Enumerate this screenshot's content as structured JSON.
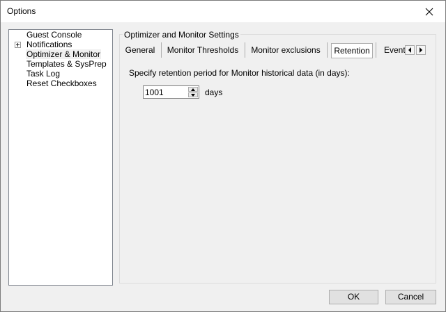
{
  "window": {
    "title": "Options",
    "close_glyph": "✕"
  },
  "tree": {
    "items": [
      {
        "label": "Guest Console",
        "expandable": false,
        "selected": false
      },
      {
        "label": "Notifications",
        "expandable": true,
        "selected": false
      },
      {
        "label": "Optimizer & Monitor",
        "expandable": false,
        "selected": true
      },
      {
        "label": "Templates & SysPrep",
        "expandable": false,
        "selected": false
      },
      {
        "label": "Task Log",
        "expandable": false,
        "selected": false
      },
      {
        "label": "Reset Checkboxes",
        "expandable": false,
        "selected": false
      }
    ]
  },
  "group": {
    "title": "Optimizer and Monitor Settings"
  },
  "tabs": {
    "items": [
      {
        "label": "General",
        "active": false
      },
      {
        "label": "Monitor Thresholds",
        "active": false
      },
      {
        "label": "Monitor exclusions",
        "active": false
      },
      {
        "label": "Retention",
        "active": true
      },
      {
        "label": "Events",
        "active": false
      }
    ],
    "scroll_left_icon": "◂",
    "scroll_right_icon": "▸"
  },
  "retention": {
    "prompt": "Specify retention period for Monitor historical data (in days):",
    "value": "1001",
    "unit": "days"
  },
  "buttons": {
    "ok": "OK",
    "cancel": "Cancel"
  }
}
